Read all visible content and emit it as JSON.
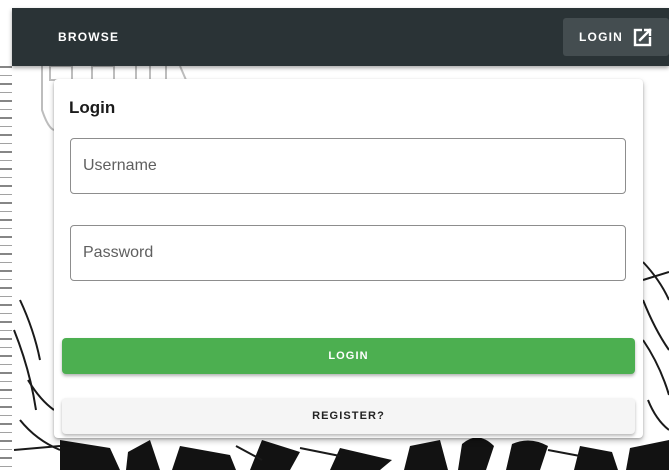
{
  "appbar": {
    "brand": "BROWSE",
    "login_label": "LOGIN",
    "login_icon": "open-in-new-icon",
    "background": "#2a3336"
  },
  "login_card": {
    "title": "Login",
    "username_placeholder": "Username",
    "username_value": "",
    "password_placeholder": "Password",
    "password_value": "",
    "login_button": "LOGIN",
    "register_button": "REGISTER?",
    "accent_color": "#4caf50"
  }
}
